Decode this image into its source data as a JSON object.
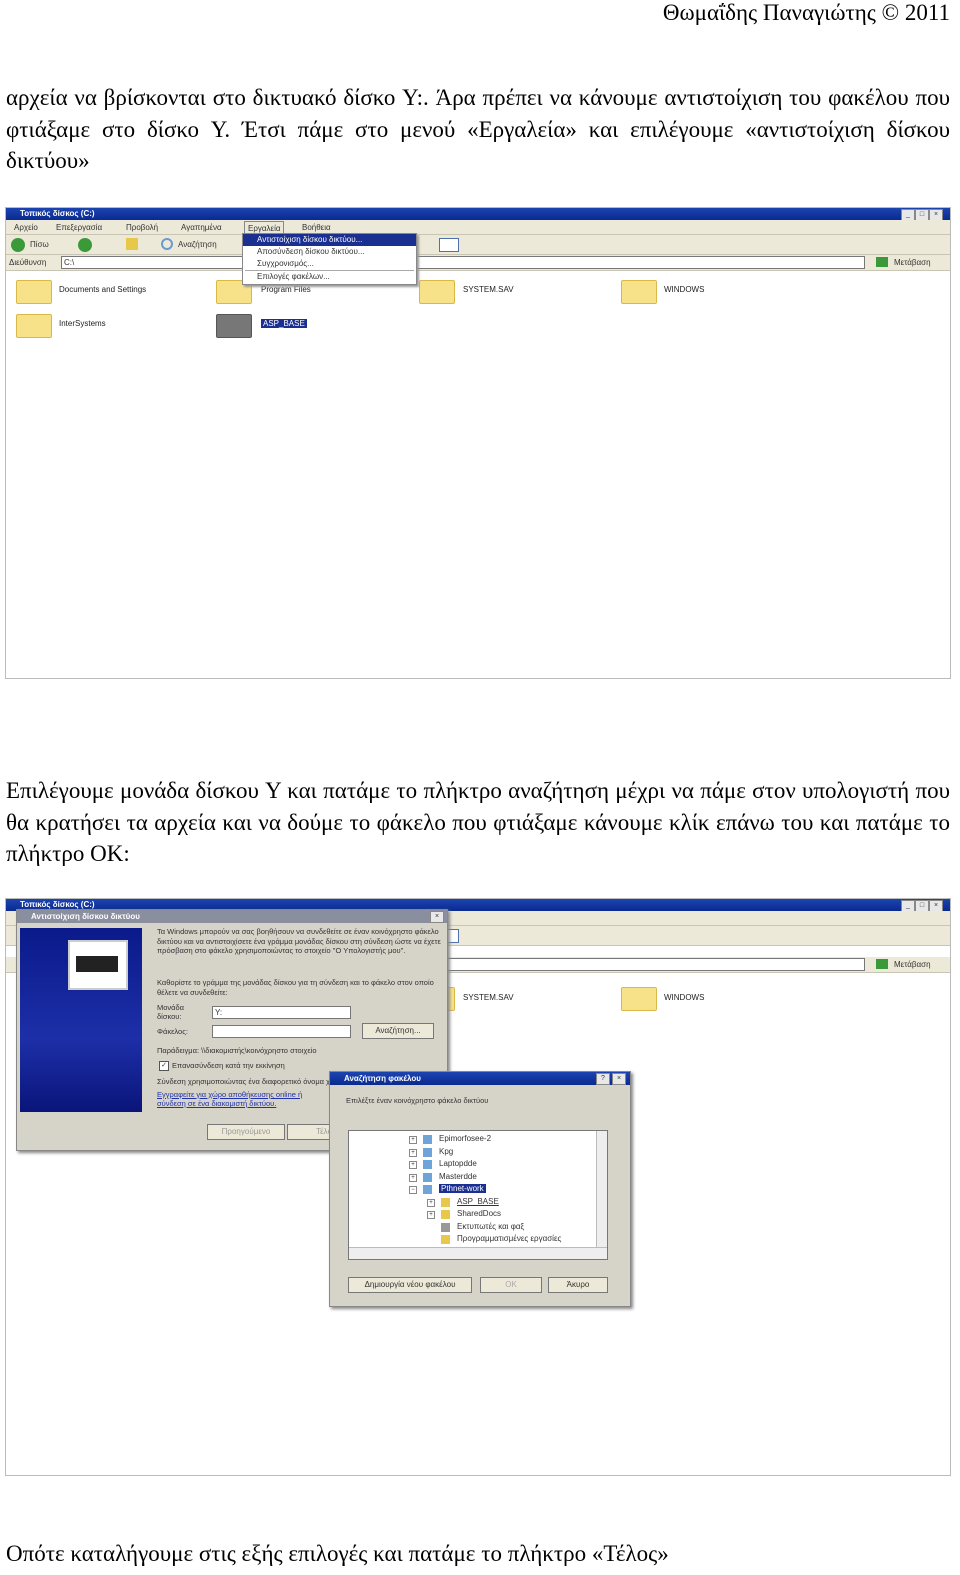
{
  "header": {
    "author": "Θωμαΐδης Παναγιώτης © 2011"
  },
  "paragraphs": [
    "αρχεία να βρίσκονται στο δικτυακό δίσκο Y:. Άρα πρέπει να κάνουμε αντιστοίχιση του φακέλου που φτιάξαμε στο δίσκο Y. Έτσι πάμε στο μενού «Εργαλεία» και επιλέγουμε «αντιστοίχιση δίσκου δικτύου»",
    "Επιλέγουμε μονάδα δίσκου Y και πατάμε το πλήκτρο αναζήτηση μέχρι να πάμε στον υπολογιστή που θα κρατήσει τα αρχεία και να δούμε το φάκελο που φτιάξαμε κάνουμε κλίκ επάνω του και πατάμε το πλήκτρο OK:",
    "Οπότε καταλήγουμε στις εξής επιλογές και πατάμε το πλήκτρο «Τέλος»"
  ],
  "explorer": {
    "title": "Τοπικός δίσκος (C:)",
    "menu": [
      "Αρχείο",
      "Επεξεργασία",
      "Προβολή",
      "Αγαπημένα",
      "Εργαλεία",
      "Βοήθεια"
    ],
    "back": "Πίσω",
    "search": "Αναζήτηση",
    "address_label": "Διεύθυνση",
    "address": "C:\\",
    "go": "Μετάβαση",
    "tools_menu": [
      "Αντιστοίχιση δίσκου δικτύου...",
      "Αποσύνδεση δίσκου δικτύου...",
      "Συγχρονισμός...",
      "Επιλογές φακέλων..."
    ],
    "folders": [
      "Documents and Settings",
      "Program Files",
      "SYSTEM.SAV",
      "WINDOWS",
      "InterSystems",
      "ASP_BASE"
    ]
  },
  "map_dialog": {
    "title": "Αντιστοίχιση δίσκου δικτύου",
    "intro": "Τα Windows μπορούν να σας βοηθήσουν να συνδεθείτε σε έναν κοινόχρηστο φάκελο δικτύου και να αντιστοιχίσετε ένα γράμμα μονάδας δίσκου στη σύνδεση ώστε να έχετε πρόσβαση στο φάκελο χρησιμοποιώντας το στοιχείο \"Ο Υπολογιστής μου\".",
    "instruction": "Καθορίστε το γράμμα της μονάδας δίσκου για τη σύνδεση και το φάκελο στον οποίο θέλετε να συνδεθείτε:",
    "drive_label": "Μονάδα δίσκου:",
    "drive_value": "Y:",
    "folder_label": "Φάκελος:",
    "folder_value": "",
    "browse": "Αναζήτηση...",
    "example": "Παράδειγμα: \\\\διακομιστής\\κοινόχρηστο στοιχείο",
    "reconnect": "Επανασύνδεση κατά την εκκίνηση",
    "reconnect_checked": true,
    "other_user": "Σύνδεση χρησιμοποιώντας ένα διαφορετικό όνομα χρήστη.",
    "signup": "Εγγραφείτε για χώρο αποθήκευσης online ή σύνδεση σε ένα διακομιστή δικτύου.",
    "finish": "Προηγούμενο",
    "next": "Τέλος"
  },
  "browse_dialog": {
    "title": "Αναζήτηση φακέλου",
    "help": "?",
    "close": "×",
    "prompt": "Επιλέξτε έναν κοινόχρηστο φάκελο δικτύου",
    "tree": [
      "Epimorfosee-2",
      "Kpg",
      "Laptopdde",
      "Masterdde",
      "Pthnet-work",
      "ASP_BASE",
      "SharedDocs",
      "Εκτυπωτές και φαξ",
      "Προγραμματισμένες εργασίες"
    ],
    "new_folder": "Δημιουργία νέου φακέλου",
    "ok": "OK",
    "cancel": "Άκυρο"
  }
}
